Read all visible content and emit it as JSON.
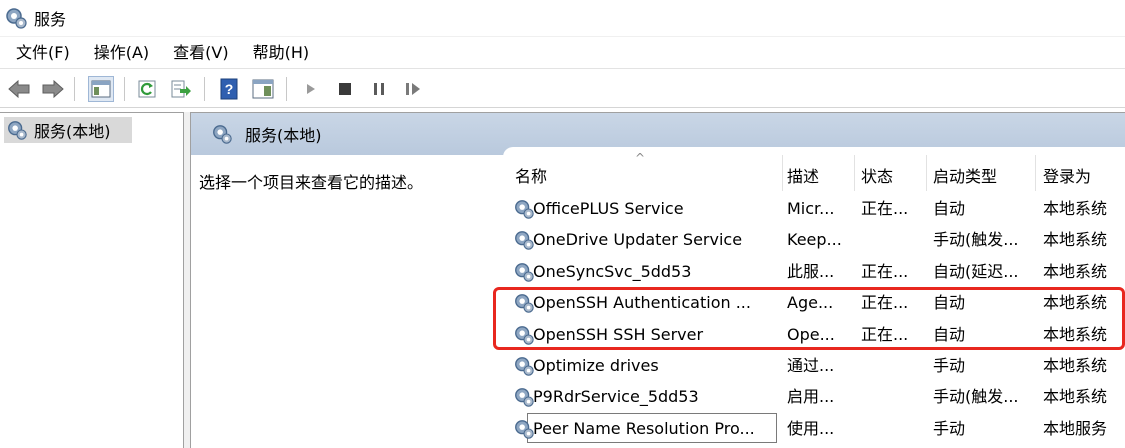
{
  "window": {
    "title": "服务",
    "icon": "services-gear-icon"
  },
  "menu": [
    "文件(F)",
    "操作(A)",
    "查看(V)",
    "帮助(H)"
  ],
  "toolbar": {
    "icons": [
      "back-arrow-icon",
      "forward-arrow-icon",
      "show-hide-console-tree-icon",
      "refresh-icon",
      "export-list-icon",
      "help-icon",
      "properties-pane-icon",
      "start-service-icon",
      "stop-service-icon",
      "pause-service-icon",
      "restart-service-icon"
    ]
  },
  "tree": {
    "selected": "服务(本地)"
  },
  "pane": {
    "header": "服务(本地)",
    "description_hint": "选择一个项目来查看它的描述。"
  },
  "table": {
    "columns": [
      "名称",
      "描述",
      "状态",
      "启动类型",
      "登录为"
    ],
    "sort_indicator": "^",
    "rows": [
      {
        "name": "OfficePLUS Service",
        "desc": "Micr...",
        "status": "正在...",
        "startup": "自动",
        "logon": "本地系统"
      },
      {
        "name": "OneDrive Updater Service",
        "desc": "Keep...",
        "status": "",
        "startup": "手动(触发...",
        "logon": "本地系统"
      },
      {
        "name": "OneSyncSvc_5dd53",
        "desc": "此服...",
        "status": "正在...",
        "startup": "自动(延迟...",
        "logon": "本地系统"
      },
      {
        "name": "OpenSSH Authentication ...",
        "desc": "Age...",
        "status": "正在...",
        "startup": "自动",
        "logon": "本地系统"
      },
      {
        "name": "OpenSSH SSH Server",
        "desc": "Ope...",
        "status": "正在...",
        "startup": "自动",
        "logon": "本地系统"
      },
      {
        "name": "Optimize drives",
        "desc": "通过...",
        "status": "",
        "startup": "手动",
        "logon": "本地系统"
      },
      {
        "name": "P9RdrService_5dd53",
        "desc": "启用...",
        "status": "",
        "startup": "手动(触发...",
        "logon": "本地系统"
      },
      {
        "name": "Peer Name Resolution Pro...",
        "desc": "使用...",
        "status": "",
        "startup": "手动",
        "logon": "本地服务"
      }
    ]
  },
  "highlight": {
    "color": "#e8271f"
  }
}
